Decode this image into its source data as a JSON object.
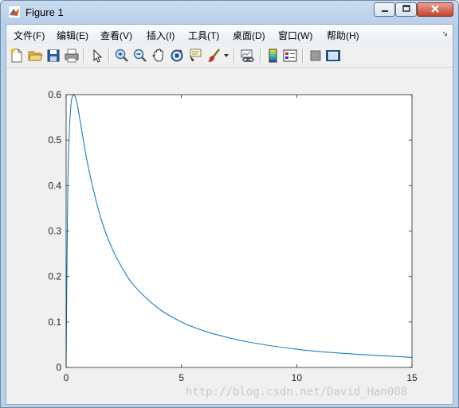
{
  "window": {
    "title": "Figure 1"
  },
  "menu": [
    "文件(F)",
    "编辑(E)",
    "查看(V)",
    "插入(I)",
    "工具(T)",
    "桌面(D)",
    "窗口(W)",
    "帮助(H)"
  ],
  "toolbar_icons": [
    "new-figure-icon",
    "open-file-icon",
    "save-icon",
    "print-icon",
    "select-arrow-icon",
    "zoom-in-icon",
    "zoom-out-icon",
    "pan-hand-icon",
    "rotate-3d-icon",
    "data-cursor-icon",
    "brush-icon",
    "link-plot-icon",
    "colorbar-icon",
    "legend-icon",
    "hide-plot-tools-icon",
    "show-plot-tools-icon"
  ],
  "watermark": "http://blog.csdn.net/David_Han008",
  "colors": {
    "line": "#0072bd",
    "axes": "#262626"
  },
  "chart_data": {
    "type": "line",
    "title": "",
    "xlabel": "",
    "ylabel": "",
    "xlim": [
      0,
      15
    ],
    "ylim": [
      0,
      0.6
    ],
    "xticks": [
      "0",
      "5",
      "10",
      "15"
    ],
    "yticks": [
      "0",
      "0.1",
      "0.2",
      "0.3",
      "0.4",
      "0.5",
      "0.6"
    ],
    "grid": false,
    "series": [
      {
        "x": [
          0,
          0.05,
          0.1,
          0.2,
          0.3,
          0.4,
          0.5,
          0.75,
          1,
          1.5,
          2,
          2.5,
          3,
          4,
          5,
          6,
          7,
          8,
          10,
          12,
          15
        ],
        "values": [
          0,
          0.299,
          0.465,
          0.572,
          0.599,
          0.594,
          0.574,
          0.499,
          0.431,
          0.329,
          0.261,
          0.213,
          0.177,
          0.13,
          0.1,
          0.08,
          0.066,
          0.055,
          0.04,
          0.031,
          0.022
        ]
      }
    ]
  }
}
